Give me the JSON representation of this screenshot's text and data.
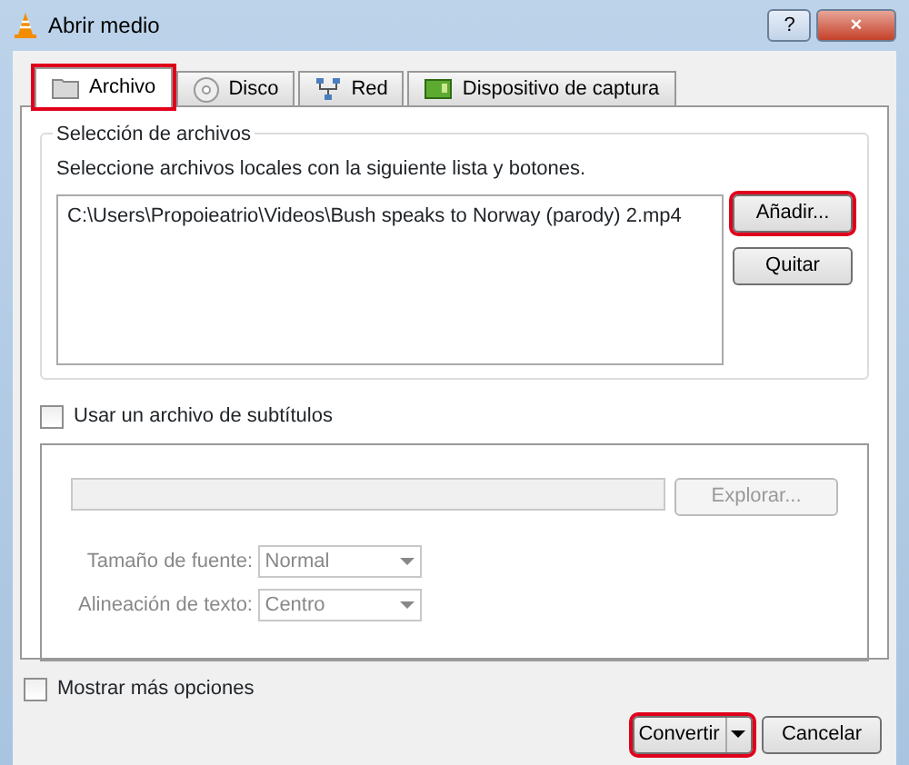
{
  "window": {
    "title": "Abrir medio",
    "buttons": [
      "?",
      "×"
    ]
  },
  "tabs": [
    {
      "label": "Archivo",
      "selected": true,
      "highlighted": true
    },
    {
      "label": "Disco",
      "selected": false,
      "highlighted": false
    },
    {
      "label": "Red",
      "selected": false,
      "highlighted": false
    },
    {
      "label": "Dispositivo de captura",
      "selected": false,
      "highlighted": false
    }
  ],
  "file_selection": {
    "title": "Selección de archivos",
    "hint": "Seleccione archivos locales con la siguiente lista y botones.",
    "files": [
      "C:\\Users\\Propoieatrio\\Videos\\Bush speaks to Norway (parody) 2.mp4"
    ],
    "buttons": [
      {
        "label": "Añadir...",
        "highlighted": true
      },
      {
        "label": "Quitar",
        "highlighted": false
      }
    ]
  },
  "subtitles": {
    "label": "Usar un archivo de subtítulos",
    "checked": false,
    "browse": {
      "label": "Explorar...",
      "disabled": true
    },
    "options": [
      {
        "label": "Tamaño de fuente:",
        "value": "Normal",
        "disabled": true
      },
      {
        "label": "Alineación de texto:",
        "value": "Centro",
        "disabled": true
      }
    ]
  },
  "more_options": {
    "label": "Mostrar más opciones",
    "checked": false
  },
  "footer": {
    "buttons": [
      {
        "label": "Convertir",
        "split": true,
        "highlighted": true
      },
      {
        "label": "Cancelar",
        "split": false,
        "highlighted": false
      }
    ]
  }
}
